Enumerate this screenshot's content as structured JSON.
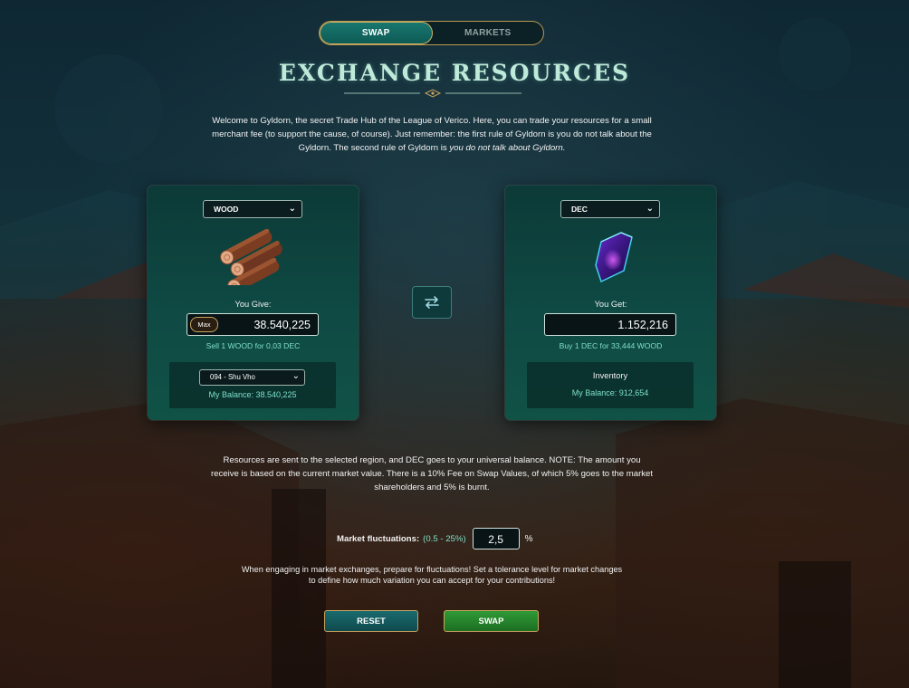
{
  "tabs": [
    {
      "label": "SWAP",
      "active": true
    },
    {
      "label": "MARKETS",
      "active": false
    }
  ],
  "title": "EXCHANGE RESOURCES",
  "intro": {
    "text": "Welcome to Gyldorn, the secret Trade Hub of the League of Verico. Here, you can trade your resources for a small merchant fee (to support the cause, of course). Just remember: the first rule of Gyldorn is you do not talk about the Gyldorn. The second rule of Gyldorn is ",
    "emphasis": "you do not talk about Gyldorn."
  },
  "give_card": {
    "resource": "WOOD",
    "icon": "wood-logs-icon",
    "label": "You Give:",
    "max_label": "Max",
    "amount": "38.540,225",
    "rate": "Sell 1 WOOD for 0,03 DEC",
    "region": "094 - Shu Vho",
    "balance": "My Balance: 38.540,225"
  },
  "get_card": {
    "resource": "DEC",
    "icon": "dec-crystal-icon",
    "label": "You Get:",
    "amount": "1.152,216",
    "rate": "Buy 1 DEC for 33,444 WOOD",
    "inventory_title": "Inventory",
    "balance": "My Balance: 912,654"
  },
  "note": "Resources are sent to the selected region, and DEC goes to your universal balance. NOTE: The amount you receive is based on the current market value. There is a 10% Fee on Swap Values, of which 5% goes to the market shareholders and 5% is burnt.",
  "fluctuation": {
    "label": "Market fluctuations:",
    "range": "(0.5 - 25%)",
    "value": "2,5",
    "unit": "%"
  },
  "hint": "When engaging in market exchanges, prepare for fluctuations! Set a tolerance level for market changes to define how much variation you can accept for your contributions!",
  "buttons": {
    "reset": "RESET",
    "swap": "SWAP"
  },
  "colors": {
    "accent_teal": "#7fe0c8",
    "gold_border": "#c9a45e",
    "card_bg": "#0f4a44",
    "swap_green": "#2f9a36"
  }
}
